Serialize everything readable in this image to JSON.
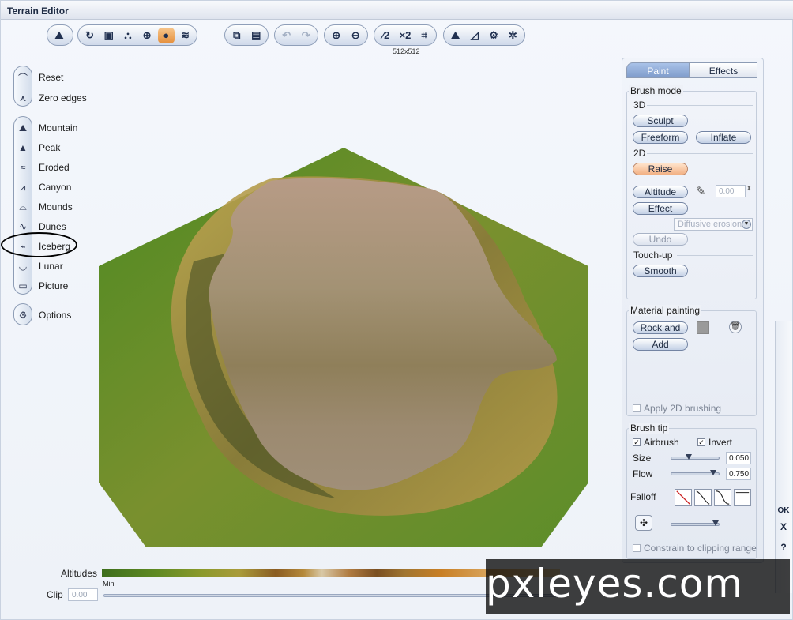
{
  "window": {
    "title": "Terrain Editor"
  },
  "toolbar": {
    "resolution": "512x512"
  },
  "left_panel": {
    "items": [
      {
        "label": "Reset"
      },
      {
        "label": "Zero edges"
      },
      {
        "label": "Mountain"
      },
      {
        "label": "Peak"
      },
      {
        "label": "Eroded"
      },
      {
        "label": "Canyon"
      },
      {
        "label": "Mounds"
      },
      {
        "label": "Dunes"
      },
      {
        "label": "Iceberg"
      },
      {
        "label": "Lunar"
      },
      {
        "label": "Picture"
      },
      {
        "label": "Options"
      }
    ]
  },
  "bottom": {
    "altitudes_label": "Altitudes",
    "min_label": "Min",
    "clip_label": "Clip",
    "clip_value": "0.00",
    "watermark": "pxleyes.com"
  },
  "right_panel": {
    "tabs": {
      "paint": "Paint",
      "effects": "Effects"
    },
    "brush_mode": {
      "title": "Brush mode",
      "sub_3d": "3D",
      "sculpt": "Sculpt",
      "freeform": "Freeform",
      "inflate": "Inflate",
      "sub_2d": "2D",
      "raise": "Raise",
      "altitude": "Altitude",
      "altitude_value": "0.00",
      "effect": "Effect",
      "effect_dropdown": "Diffusive erosion",
      "undo": "Undo",
      "touchup": "Touch-up",
      "smooth": "Smooth"
    },
    "material": {
      "title": "Material painting",
      "rock_and": "Rock and",
      "add": "Add",
      "apply_2d": "Apply 2D brushing",
      "swatch_color": "#9a9a9a"
    },
    "brush_tip": {
      "title": "Brush tip",
      "airbrush": "Airbrush",
      "invert": "Invert",
      "size_label": "Size",
      "size_value": "0.050",
      "size_level": 0.3,
      "flow_label": "Flow",
      "flow_value": "0.750",
      "flow_level": 0.85,
      "falloff_label": "Falloff",
      "constrain": "Constrain to clipping range"
    },
    "edge": {
      "ok": "OK",
      "close": "X",
      "help": "?"
    }
  }
}
